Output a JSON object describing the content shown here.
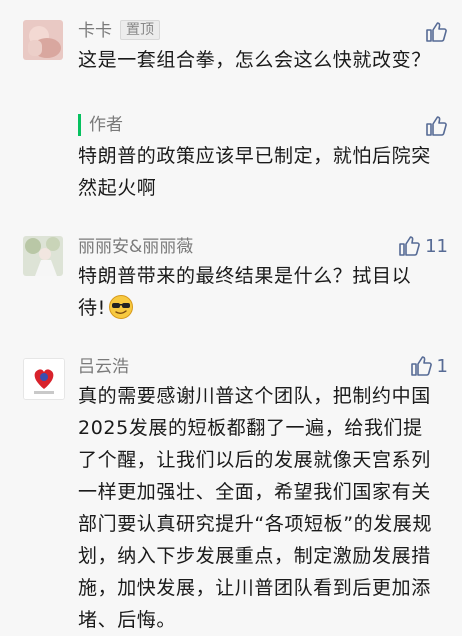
{
  "comments": [
    {
      "user": "卡卡",
      "badge": "置顶",
      "text": "这是一套组合拳，怎么会这么快就改变？",
      "reply": {
        "label": "作者",
        "text": "特朗普的政策应该早已制定，就怕后院突然起火啊"
      }
    },
    {
      "user": "丽丽安&丽丽薇",
      "likes": "11",
      "text": "特朗普带来的最终结果是什么？拭目以待!"
    },
    {
      "user": "吕云浩",
      "likes": "1",
      "text": "真的需要感谢川普这个团队，把制约中国2025发展的短板都翻了一遍，给我们提了个醒，让我们以后的发展就像天宫系列一样更加强壮、全面，希望我们国家有关部门要认真研究提升“各项短板”的发展规划，纳入下步发展重点，制定激励发展措施，加快发展，让川普团队看到后更加添堵、后悔。"
    }
  ],
  "colors": {
    "accent": "#576b95",
    "author_bar": "#07c160",
    "background": "#f7f7f7"
  },
  "icons": [
    "thumbs-up-icon",
    "sunglasses-emoji-icon"
  ]
}
